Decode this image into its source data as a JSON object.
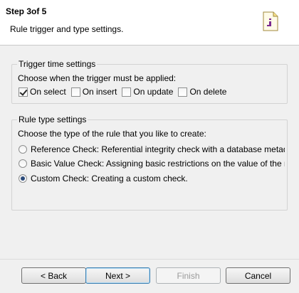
{
  "header": {
    "title": "Step 3of 5",
    "subtitle": "Rule trigger and type settings."
  },
  "colors": {
    "icon_accent": "#7b2a8f",
    "icon_yellow": "#f6e08a",
    "radio_dot": "#2b4a7a"
  },
  "trigger_group": {
    "legend": "Trigger time settings",
    "description": "Choose when the trigger must be applied:",
    "options": [
      {
        "label": "On select",
        "checked": true
      },
      {
        "label": "On insert",
        "checked": false
      },
      {
        "label": "On update",
        "checked": false
      },
      {
        "label": "On delete",
        "checked": false
      }
    ]
  },
  "rule_group": {
    "legend": "Rule type settings",
    "description": "Choose the type of the rule that you like to create:",
    "options": [
      {
        "label": "Reference Check: Referential integrity check with a database metada",
        "selected": false
      },
      {
        "label": "Basic Value Check: Assigning basic restrictions on the value of the m",
        "selected": false
      },
      {
        "label": "Custom Check: Creating a custom check.",
        "selected": true
      }
    ]
  },
  "buttons": {
    "back": "< Back",
    "next": "Next >",
    "finish": "Finish",
    "cancel": "Cancel"
  }
}
